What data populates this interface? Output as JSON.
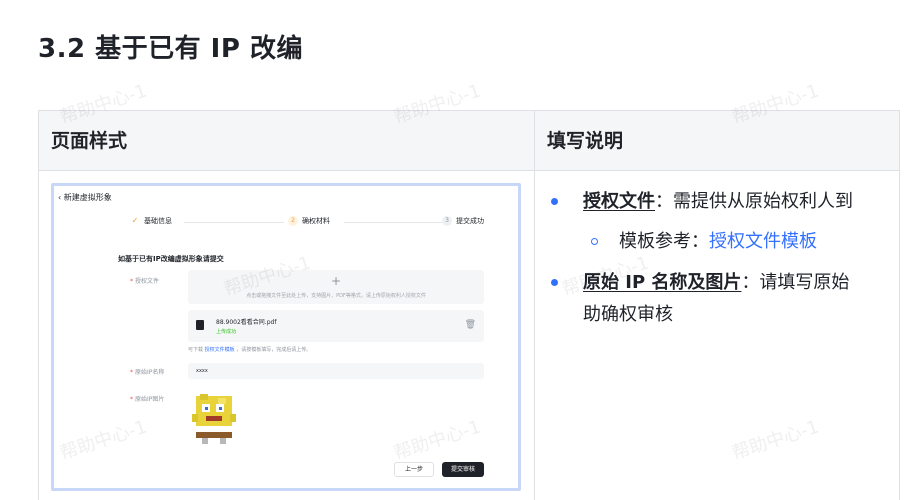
{
  "heading": "3.2 基于已有 IP 改编",
  "watermark": "帮助中心-1",
  "table": {
    "headers": [
      "页面样式",
      "填写说明"
    ]
  },
  "screenshot": {
    "back_label": "‹ 新建虚拟形象",
    "steps": [
      {
        "num": "✓",
        "label": "基础信息"
      },
      {
        "num": "2",
        "label": "确权材料"
      },
      {
        "num": "3",
        "label": "提交成功"
      }
    ],
    "form_title": "如基于已有IP改编虚拟形象请提交",
    "auth_label": "授权文件",
    "upload_plus": "+",
    "upload_hint": "点击或拖拽文件至此处上传，支持图片、PDF等格式，请上传原始权利人授权文件",
    "file_name": "88.9002看看合同.pdf",
    "file_status": "上传成功",
    "template_hint_prefix": "可下载",
    "template_hint_link": "授权文件模板",
    "template_hint_suffix": "，请按模板填写，完成后请上传。",
    "ip_name_label": "原始IP名称",
    "ip_name_value": "xxxx",
    "ip_image_label": "原始IP图片",
    "prev_button": "上一步",
    "submit_button": "提交审核"
  },
  "instructions": {
    "item1_term": "授权文件",
    "item1_text": "：需提供从原始权利人到",
    "sub1_prefix": "模板参考：",
    "sub1_link": "授权文件模板",
    "item2_term": "原始 IP 名称及图片",
    "item2_text": "：请填写原始",
    "item2_cont": "助确权审核"
  },
  "colors": {
    "accent": "#3370ff",
    "primary_button": "#1f2329",
    "header_bg": "#f5f6f7"
  }
}
